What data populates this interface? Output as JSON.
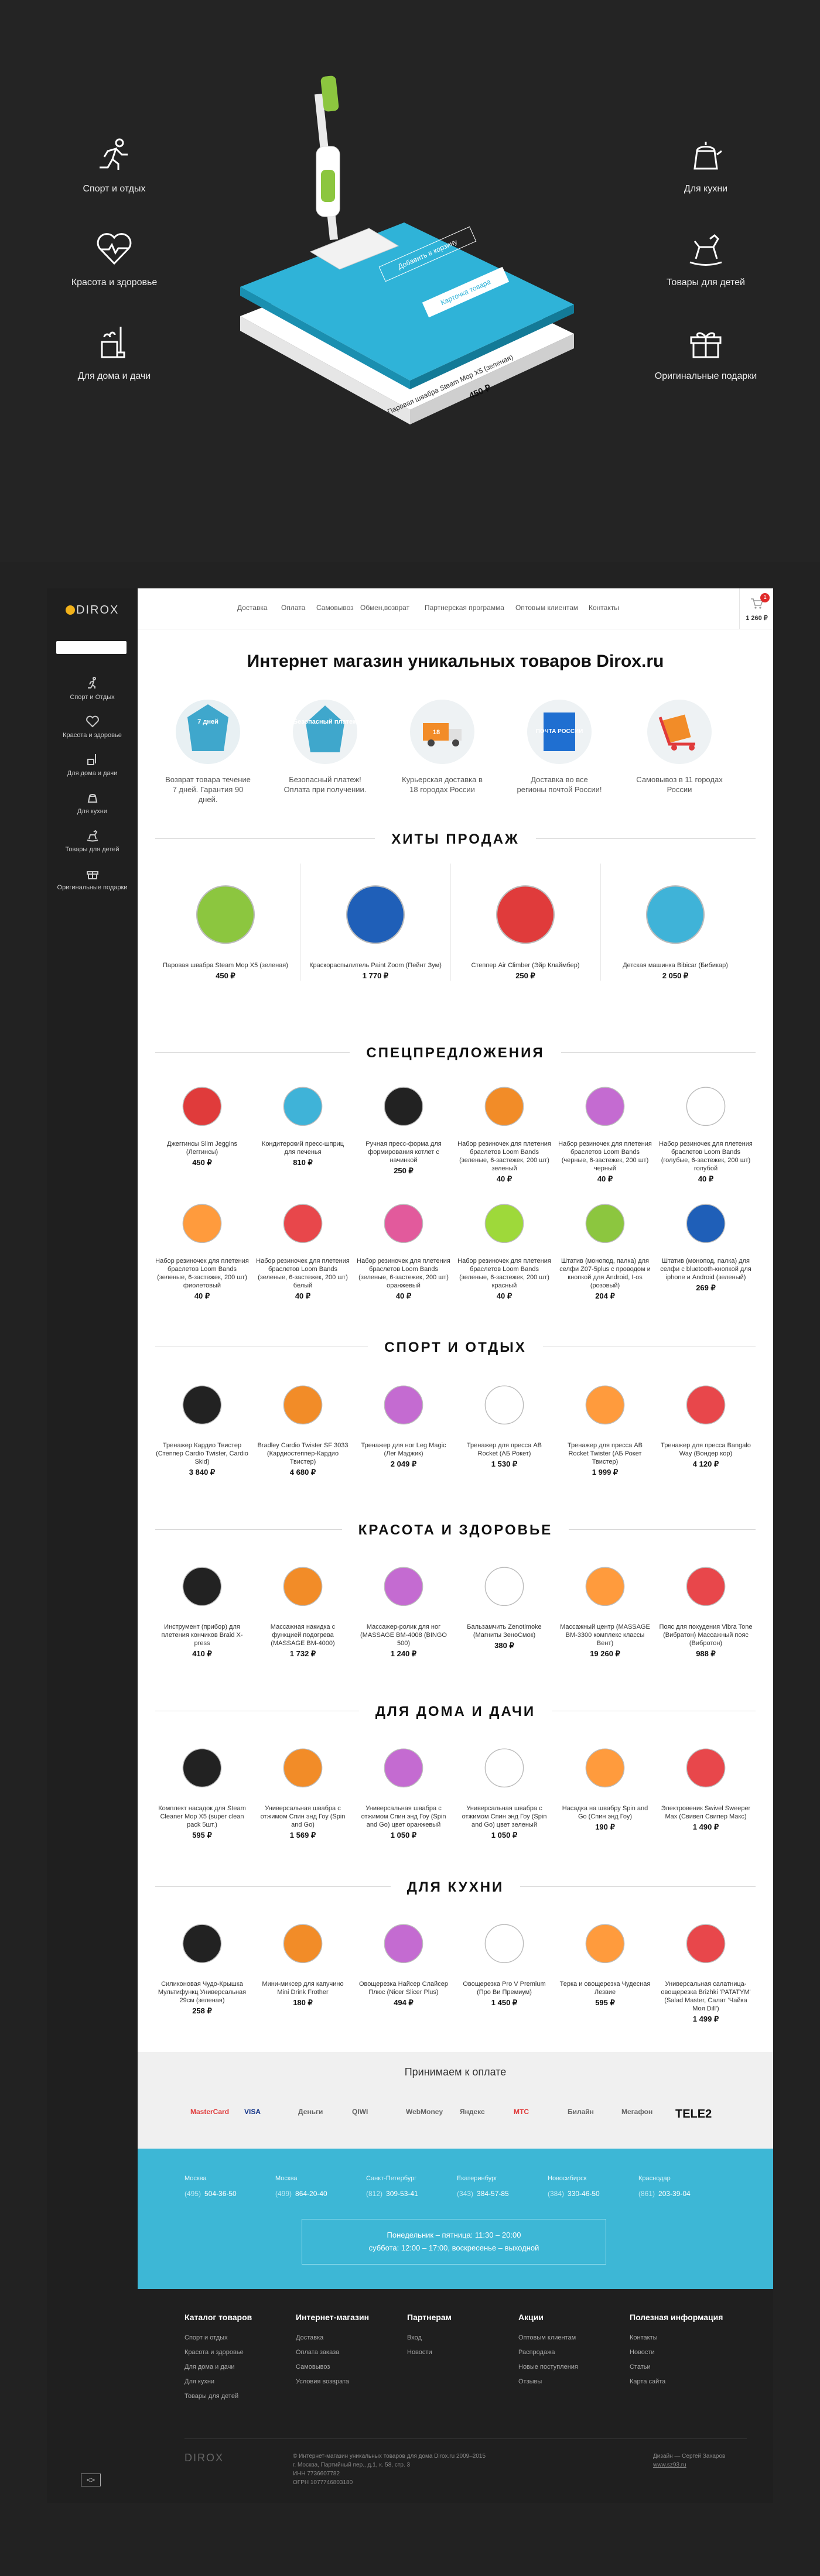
{
  "hero": {
    "categories_left": [
      "Спорт и отдых",
      "Красота и здоровье",
      "Для дома и дачи"
    ],
    "categories_right": [
      "Для кухни",
      "Товары для детей",
      "Оригинальные подарки"
    ],
    "card_product": "Паровая швабра Steam Mop X5 (зеленая)",
    "card_price": "450 ₽",
    "btn_cart": "Добавить в корзину",
    "btn_details": "Карточка товара"
  },
  "sidebar": {
    "logo": "DIROX",
    "items": [
      "Спорт и Отдых",
      "Красота и здоровье",
      "Для дома и дачи",
      "Для кухни",
      "Товары для детей",
      "Оригинальные подарки"
    ],
    "collapse": "<>"
  },
  "nav": [
    "Доставка",
    "Оплата",
    "Самовывоз",
    "Обмен,возврат",
    "Партнерская программа",
    "Оптовым клиентам",
    "Контакты"
  ],
  "cart": {
    "count": "1",
    "sum": "1 260 ₽"
  },
  "page_title": "Интернет магазин уникальных товаров Dirox.ru",
  "features": [
    {
      "badge": "7 дней",
      "text": "Возврат товара течение 7 дней. Гарантия 90 дней."
    },
    {
      "badge": "Безопасный платеж",
      "text": "Безопасный платеж! Оплата при получении."
    },
    {
      "badge": "18",
      "text": "Курьерская доставка в 18 городах России"
    },
    {
      "badge": "ПОЧТА РОССИИ",
      "text": "Доставка во все регионы почтой России!"
    },
    {
      "badge": "",
      "text": "Самовывоз в 11 городах России"
    }
  ],
  "sections": {
    "hits": "ХИТЫ ПРОДАЖ",
    "special": "СПЕЦПРЕДЛОЖЕНИЯ",
    "sport": "СПОРТ И ОТДЫХ",
    "beauty": "КРАСОТА И ЗДОРОВЬЕ",
    "home": "ДЛЯ ДОМА И ДАЧИ",
    "kitchen": "ДЛЯ КУХНИ"
  },
  "hits": [
    {
      "name": "Паровая швабра Steam Mop X5 (зеленая)",
      "price": "450 ₽"
    },
    {
      "name": "Краскораспылитель Paint Zoom (Пейнт Зум)",
      "price": "1 770 ₽"
    },
    {
      "name": "Степпер Air Climber (Эйр Клаймбер)",
      "price": "250 ₽"
    },
    {
      "name": "Детская машинка Bibicar (Бибикар)",
      "price": "2 050 ₽"
    }
  ],
  "special": [
    {
      "name": "Джеггинсы Slim Jeggins (Леггинсы)",
      "price": "450 ₽"
    },
    {
      "name": "Кондитерский пресс-шприц для печенья",
      "price": "810 ₽"
    },
    {
      "name": "Ручная пресс-форма для формирования котлет с начинкой",
      "price": "250 ₽"
    },
    {
      "name": "Набор резиночек для плетения браслетов Loom Bands (зеленые, 6-застежек, 200 шт) зеленый",
      "price": "40 ₽"
    },
    {
      "name": "Набор резиночек для плетения браслетов Loom Bands (черные, 6-застежек, 200 шт) черный",
      "price": "40 ₽"
    },
    {
      "name": "Набор резиночек для плетения браслетов Loom Bands (голубые, 6-застежек, 200 шт) голубой",
      "price": "40 ₽"
    },
    {
      "name": "Набор резиночек для плетения браслетов Loom Bands (зеленые, 6-застежек, 200 шт) фиолетовый",
      "price": "40 ₽"
    },
    {
      "name": "Набор резиночек для плетения браслетов Loom Bands (зеленые, 6-застежек, 200 шт) белый",
      "price": "40 ₽"
    },
    {
      "name": "Набор резиночек для плетения браслетов Loom Bands (зеленые, 6-застежек, 200 шт) оранжевый",
      "price": "40 ₽"
    },
    {
      "name": "Набор резиночек для плетения браслетов Loom Bands (зеленые, 6-застежек, 200 шт) красный",
      "price": "40 ₽"
    },
    {
      "name": "Штатив (монопод, палка) для селфи Z07-5plus c проводом и кнопкой для Android, I-os (розовый)",
      "price": "204 ₽"
    },
    {
      "name": "Штатив (монопод, палка) для селфи с bluetooth-кнопкой для iphone и Android (зеленый)",
      "price": "269 ₽"
    }
  ],
  "sport": [
    {
      "name": "Тренажер Кардио Твистер (Степпер Cardio Twister, Cardio Skid)",
      "price": "3 840 ₽"
    },
    {
      "name": "Bradley Cardio Twister SF 3033 (Кардиостеппер-Кардио Твистер)",
      "price": "4 680 ₽"
    },
    {
      "name": "Тренажер для ног Leg Magic (Лег Мэджик)",
      "price": "2 049 ₽"
    },
    {
      "name": "Тренажер для пресса AB Rocket (АБ Рокет)",
      "price": "1 530 ₽"
    },
    {
      "name": "Тренажер для пресса AB Rocket Twister (АБ Рокет Твистер)",
      "price": "1 999 ₽"
    },
    {
      "name": "Тренажер для пресса Bangalo Way (Вондер кор)",
      "price": "4 120 ₽"
    }
  ],
  "beauty": [
    {
      "name": "Инструмент (прибор) для плетения кончиков Braid X-press",
      "price": "410 ₽"
    },
    {
      "name": "Массажная накидка с функцией подогрева (MASSAGE BM-4000)",
      "price": "1 732 ₽"
    },
    {
      "name": "Массажер-ролик для ног (MASSAGE BM-4008 (BINGO 500)",
      "price": "1 240 ₽"
    },
    {
      "name": "Бальзамчить Zenotimoke (Магниты ЗеноСмок)",
      "price": "380 ₽"
    },
    {
      "name": "Массажный центр (MASSAGE BM-3300 комплекс классы Вент)",
      "price": "19 260 ₽"
    },
    {
      "name": "Пояс для похудения Vibra Tone (Вибратон) Массажный пояс (Вибротон)",
      "price": "988 ₽"
    }
  ],
  "home": [
    {
      "name": "Комплект насадок для Steam Cleaner Mop X5 (super clean pack 5шт.)",
      "price": "595 ₽"
    },
    {
      "name": "Универсальная швабра с отжимом Спин энд Гоу (Spin and Go)",
      "price": "1 569 ₽"
    },
    {
      "name": "Универсальная швабра с отжимом Спин энд Гоу (Spin and Go) цвет оранжевый",
      "price": "1 050 ₽"
    },
    {
      "name": "Универсальная швабра с отжимом Спин энд Гоу (Spin and Go) цвет зеленый",
      "price": "1 050 ₽"
    },
    {
      "name": "Насадка на швабру Spin and Go (Спин энд Гоу)",
      "price": "190 ₽"
    },
    {
      "name": "Электровеник Swivel Sweeper Max (Свивел Свипер Макс)",
      "price": "1 490 ₽"
    }
  ],
  "kitchen": [
    {
      "name": "Силиконовая Чудо-Крышка Мультифункц Универсальная 29см (зеленая)",
      "price": "258 ₽"
    },
    {
      "name": "Мини-миксер для капучино Mini Drink Frother",
      "price": "180 ₽"
    },
    {
      "name": "Овощерезка Найсер Слайсер Плюс (Nicer Slicer Plus)",
      "price": "494 ₽"
    },
    {
      "name": "Овощерезка Pro V Premium (Про Ви Премиум)",
      "price": "1 450 ₽"
    },
    {
      "name": "Терка и овощерезка Чудесная Лезвие",
      "price": "595 ₽"
    },
    {
      "name": "Универсальная салатница-овощерезка Brizhki 'PATATYM' (Salad Master, Салат 'Чайка Моя Dill')",
      "price": "1 499 ₽"
    }
  ],
  "payment": {
    "title": "Принимаем к оплате",
    "logos": [
      "MasterCard",
      "VISA",
      "Деньги",
      "QIWI",
      "WebMoney",
      "Яндекс",
      "МТС",
      "Билайн",
      "Мегафон",
      "TELE2"
    ]
  },
  "contacts": {
    "cities": [
      {
        "city": "Москва",
        "code": "(495)",
        "phone": "504-36-50"
      },
      {
        "city": "Москва",
        "code": "(499)",
        "phone": "864-20-40"
      },
      {
        "city": "Санкт-Петербург",
        "code": "(812)",
        "phone": "309-53-41"
      },
      {
        "city": "Екатеринбург",
        "code": "(343)",
        "phone": "384-57-85"
      },
      {
        "city": "Новосибирск",
        "code": "(384)",
        "phone": "330-46-50"
      },
      {
        "city": "Краснодар",
        "code": "(861)",
        "phone": "203-39-04"
      }
    ],
    "hours_line1": "Понедельник – пятница: 11:30 – 20:00",
    "hours_line2": "суббота: 12:00 – 17:00, воскресенье – выходной"
  },
  "footer": {
    "cols": [
      {
        "title": "Каталог товаров",
        "items": [
          "Спорт и отдых",
          "Красота и здоровье",
          "Для дома и дачи",
          "Для кухни",
          "Товары для детей"
        ]
      },
      {
        "title": "Интернет-магазин",
        "items": [
          "Доставка",
          "Оплата заказа",
          "Самовывоз",
          "Условия возврата"
        ]
      },
      {
        "title": "Партнерам",
        "items": [
          "Вход",
          "Новости"
        ]
      },
      {
        "title": "Акции",
        "items": [
          "Оптовым клиентам",
          "Распродажа",
          "Новые поступления",
          "Отзывы"
        ]
      },
      {
        "title": "Полезная информация",
        "items": [
          "Контакты",
          "Новости",
          "Статьи",
          "Карта сайта"
        ]
      }
    ],
    "logo": "DIROX",
    "copyright": "© Интернет-магазин уникальных товаров для дома Dirox.ru 2009–2015",
    "address": "г. Москва, Партийный пер., д.1, к. 58, стр. 3",
    "inn": "ИНН 7736607782",
    "ogrn": "ОГРН 1077746803180",
    "design_credit": "Дизайн — Сергей Захаров",
    "design_site": "www.sz93.ru"
  }
}
